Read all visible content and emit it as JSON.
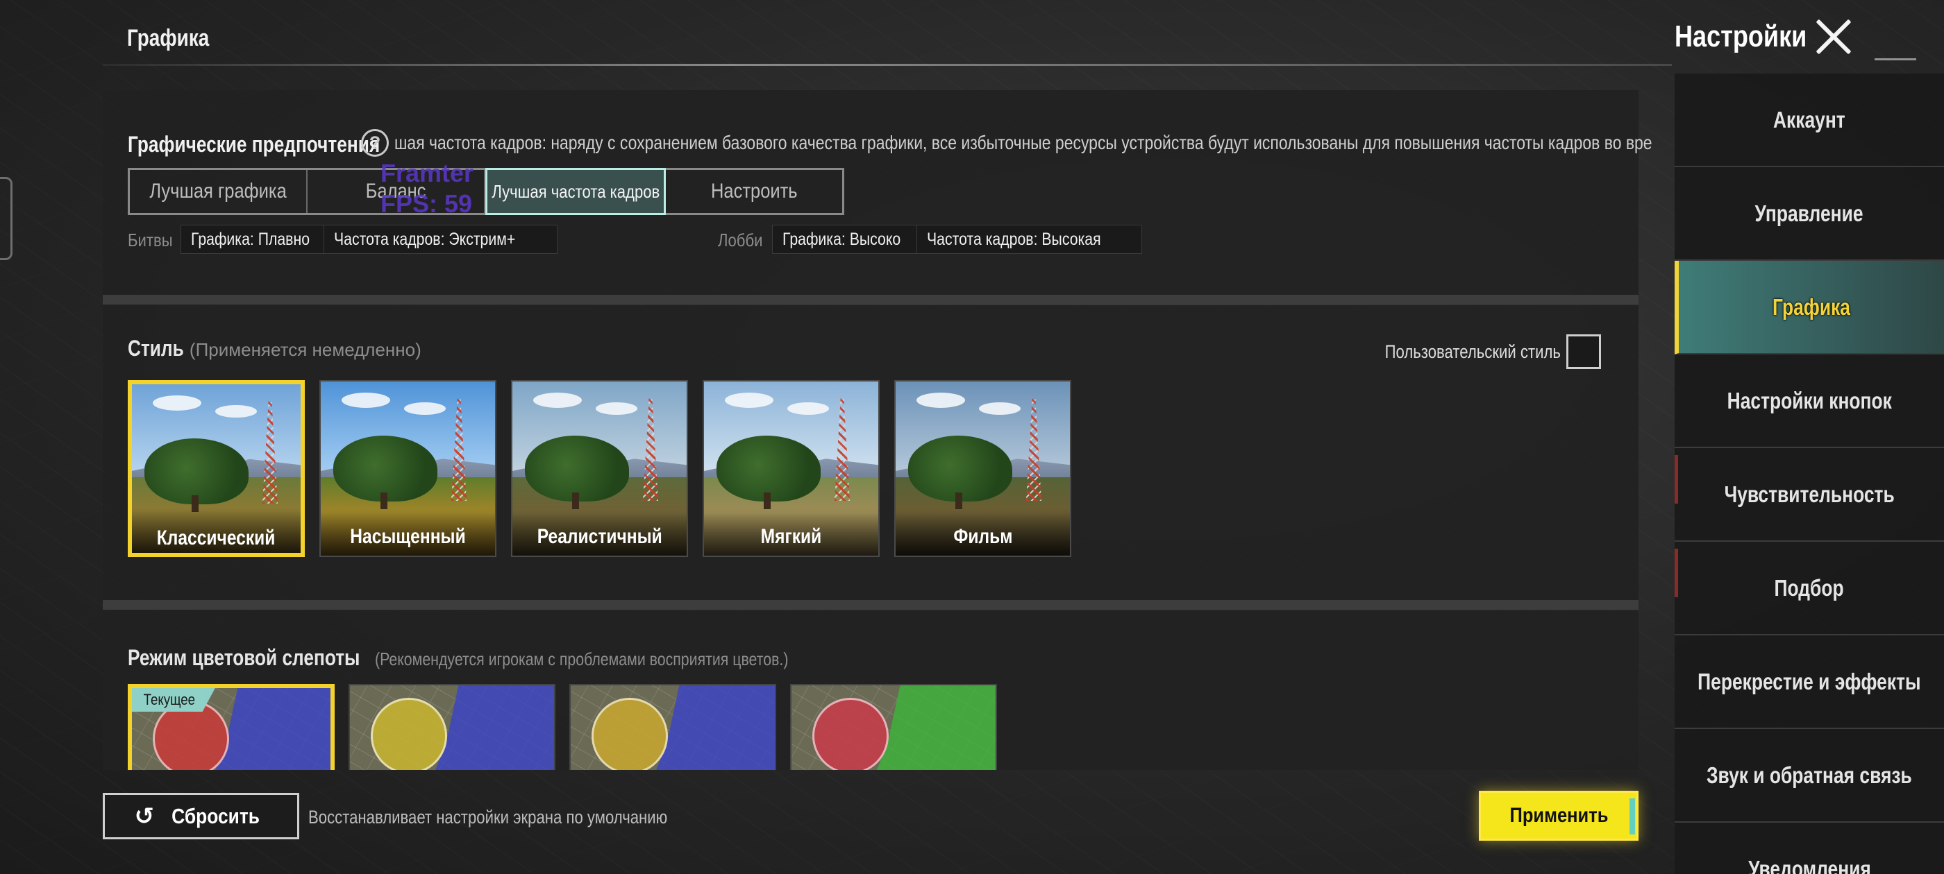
{
  "header": {
    "section_title": "Графика",
    "settings_title": "Настройки"
  },
  "graphics_prefs": {
    "label": "Графические предпочтения",
    "help_icon": "?",
    "description": "шая частота кадров: наряду с сохранением базового качества графики, все избыточные ресурсы устройства будут использованы для повышения частоты кадров во вре",
    "options": [
      "Лучшая графика",
      "Баланс",
      "Лучшая частота кадров",
      "Настроить"
    ],
    "selected": "Лучшая частота кадров",
    "overlay_line1": "Framter",
    "overlay_line2": "FPS: 59",
    "battle_label": "Битвы",
    "battle_graphics": "Графика: Плавно",
    "battle_fps": "Частота кадров: Экстрим+",
    "lobby_label": "Лобби",
    "lobby_graphics": "Графика: Высоко",
    "lobby_fps": "Частота кадров: Высокая"
  },
  "style": {
    "title": "Стиль",
    "subtitle": "(Применяется немедленно)",
    "custom_label": "Пользовательский стиль",
    "cards": [
      "Классический",
      "Насыщенный",
      "Реалистичный",
      "Мягкий",
      "Фильм"
    ],
    "selected": "Классический"
  },
  "colorblind": {
    "title": "Режим цветовой слепоты",
    "subtitle": "(Рекомендуется игрокам с проблемами восприятия цветов.)",
    "current_badge": "Текущее",
    "palettes": [
      {
        "circle": "#c93a3a",
        "zone": "#3a44c9"
      },
      {
        "circle": "#c9b52f",
        "zone": "#3a44c9"
      },
      {
        "circle": "#c9a82f",
        "zone": "#3a44c9"
      },
      {
        "circle": "#c93a4a",
        "zone": "#3cb43a"
      }
    ]
  },
  "footer": {
    "reset_label": "Сбросить",
    "reset_icon": "↺",
    "reset_hint": "Восстанавливает настройки экрана по умолчанию",
    "apply_label": "Применить"
  },
  "sidebar": {
    "items": [
      "Аккаунт",
      "Управление",
      "Графика",
      "Настройки кнопок",
      "Чувствительность",
      "Подбор",
      "Перекрестие и эффекты",
      "Звук и обратная связь",
      "Уведомления"
    ],
    "active": "Графика"
  },
  "colors": {
    "accent_yellow": "#f3d22b",
    "accent_teal": "#8fd1c6",
    "panel_bg": "#222222"
  }
}
